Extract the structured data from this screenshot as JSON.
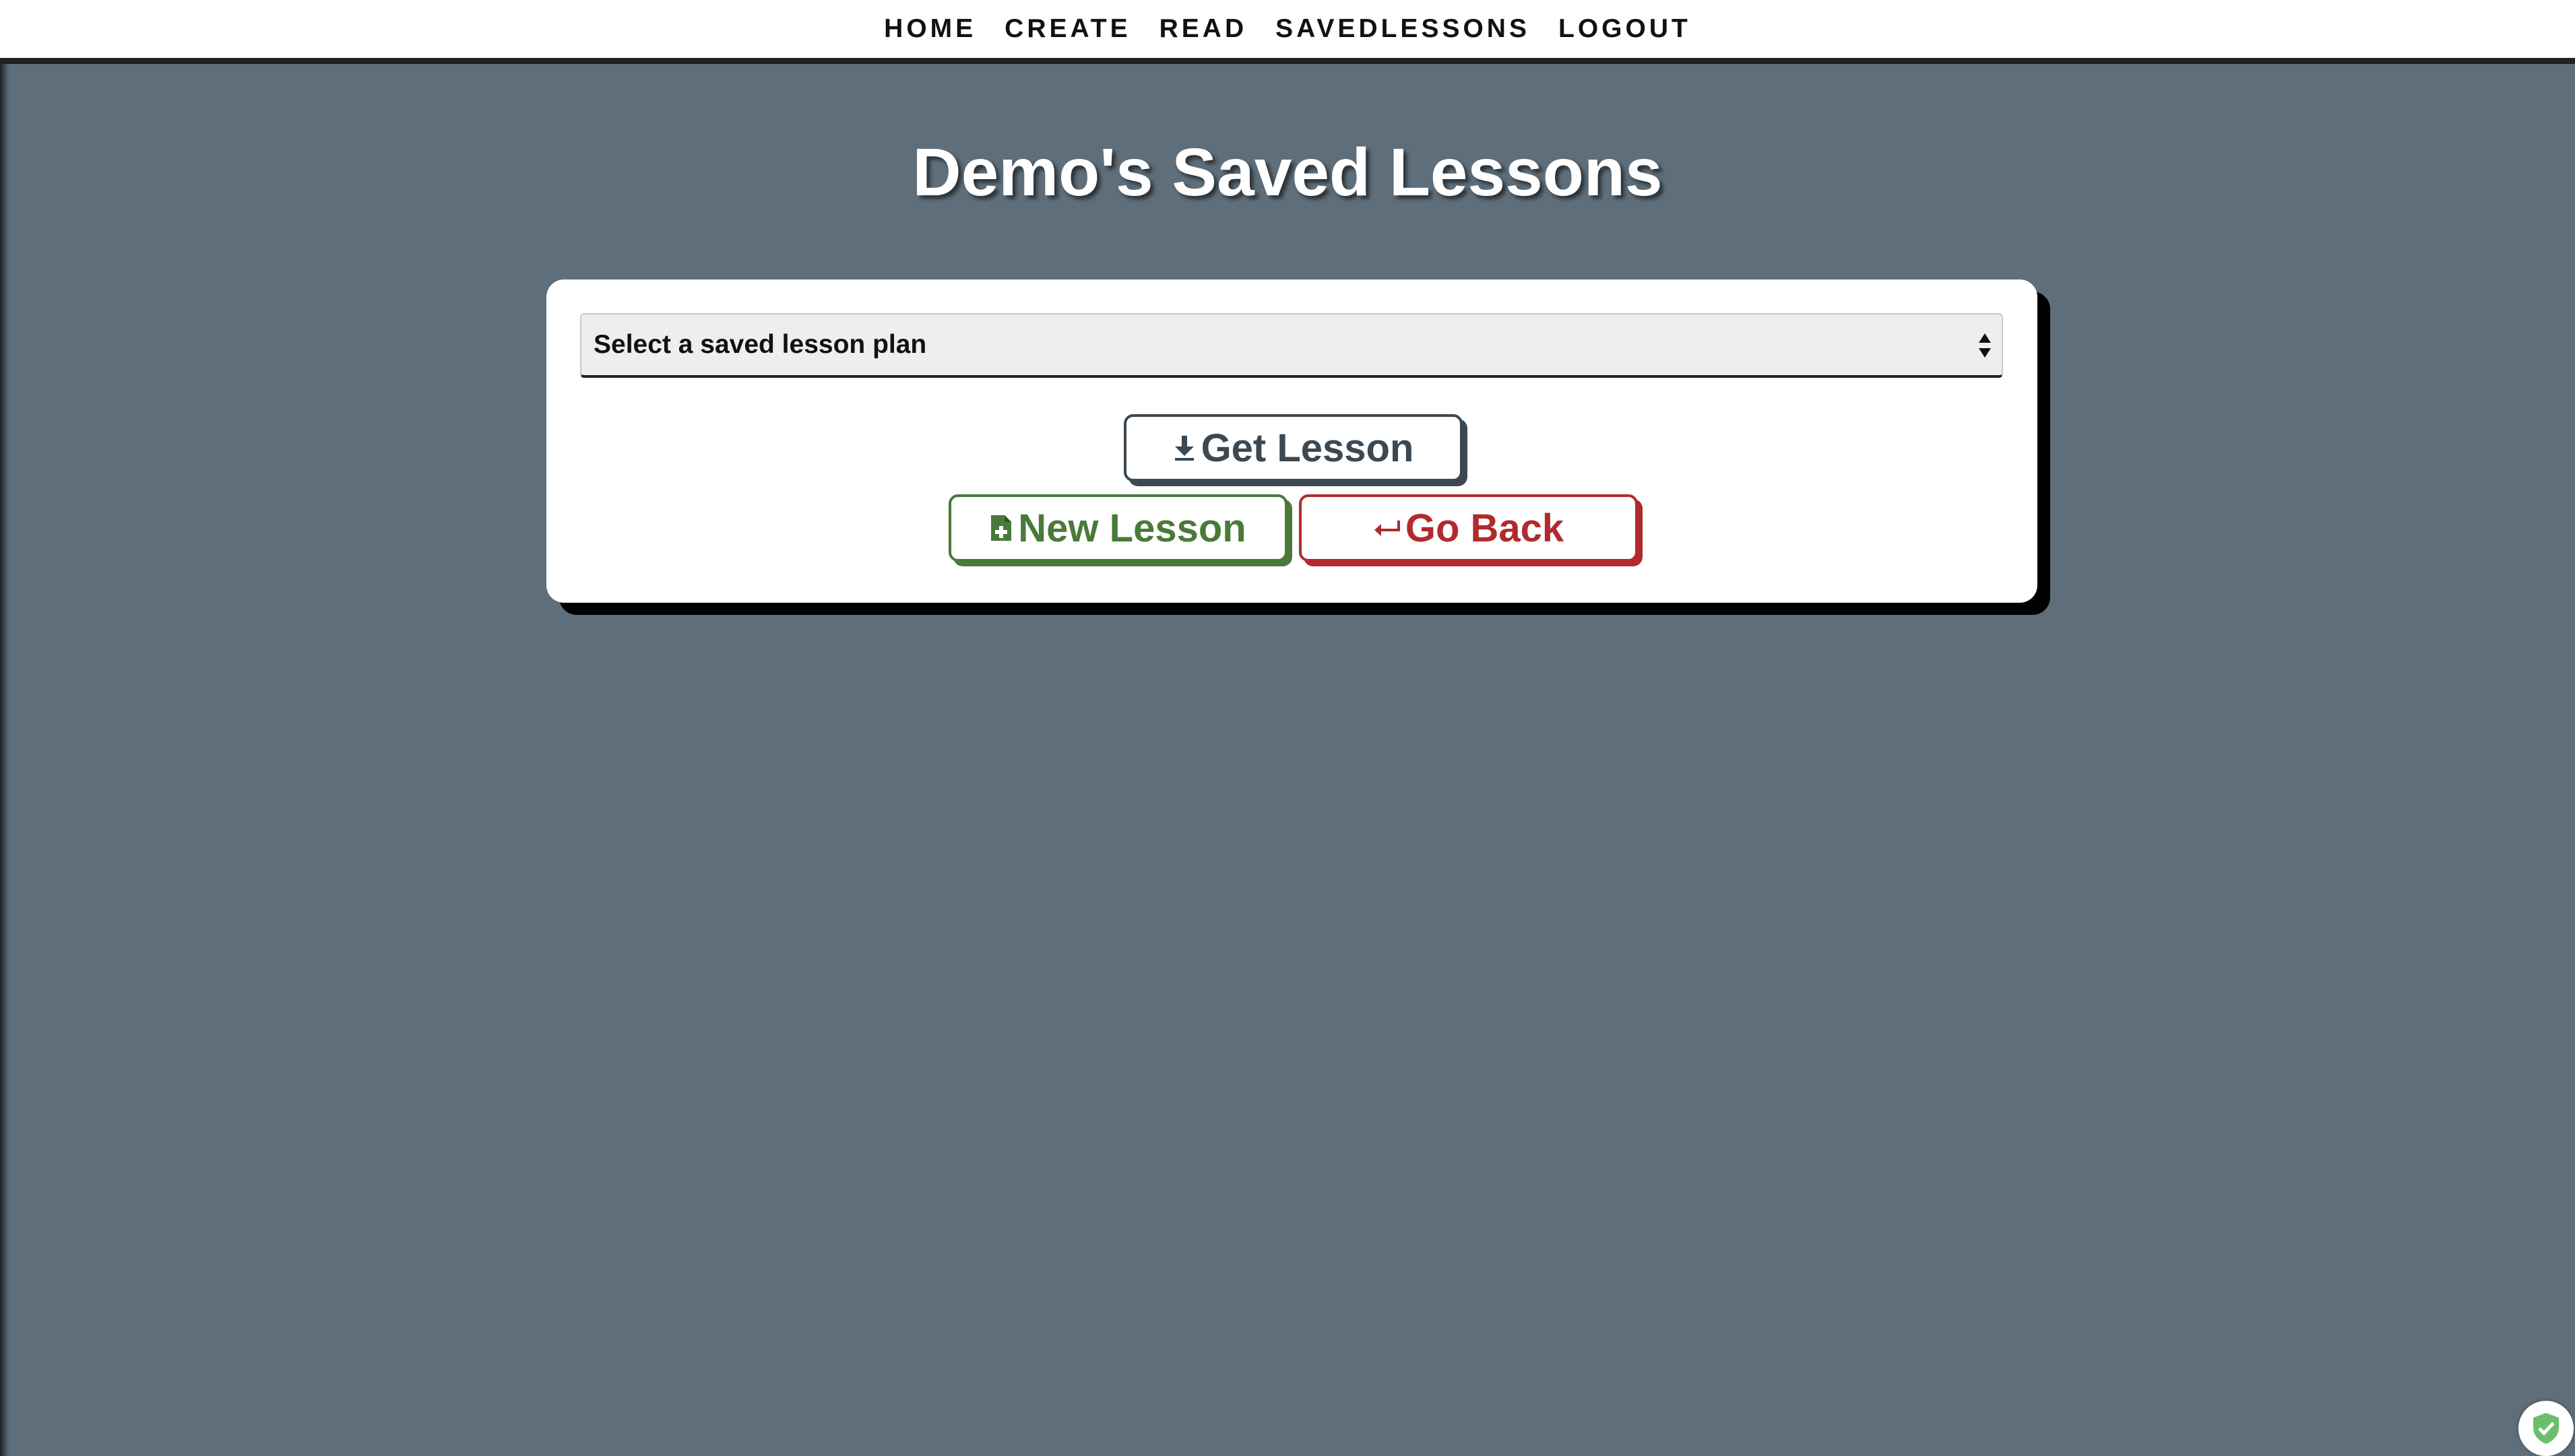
{
  "nav": {
    "items": [
      {
        "label": "HOME"
      },
      {
        "label": "CREATE"
      },
      {
        "label": "READ"
      },
      {
        "label": "SAVEDLESSONS"
      },
      {
        "label": "LOGOUT"
      }
    ]
  },
  "page": {
    "title": "Demo's Saved Lessons"
  },
  "lesson_select": {
    "selected": "Select a saved lesson plan"
  },
  "buttons": {
    "get_lesson": {
      "label": "Get Lesson",
      "icon": "download-icon",
      "color": "#3c4852"
    },
    "new_lesson": {
      "label": "New Lesson",
      "icon": "file-plus-icon",
      "color": "#4a7a3a"
    },
    "go_back": {
      "label": "Go Back",
      "icon": "return-arrow-icon",
      "color": "#b02a2e"
    }
  },
  "colors": {
    "background": "#5e6e7a",
    "card": "#ffffff",
    "nav_border": "#1d2226"
  }
}
